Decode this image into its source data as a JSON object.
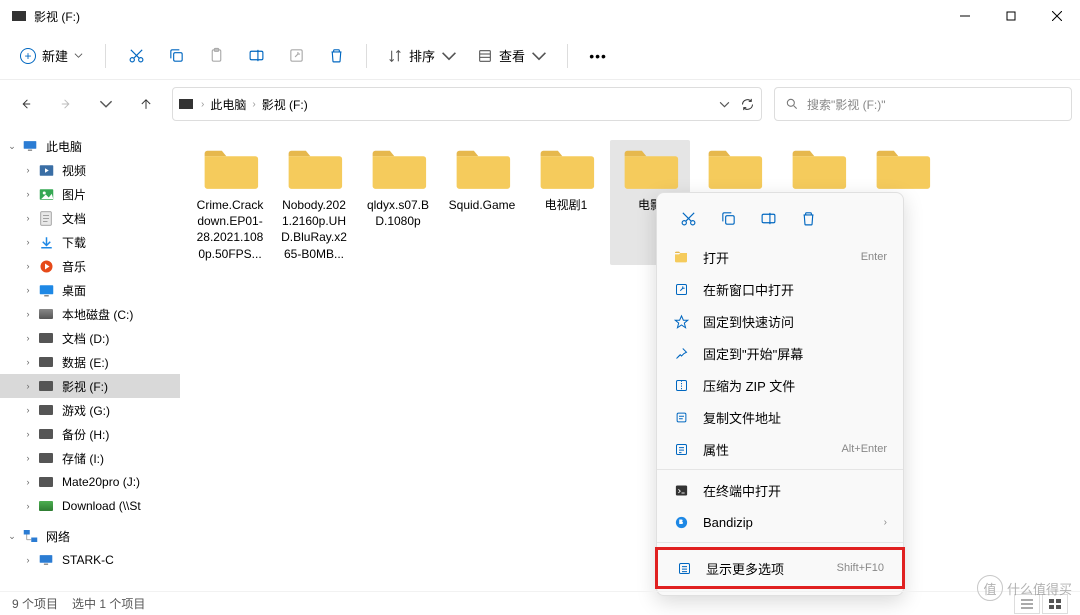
{
  "window": {
    "title": "影视 (F:)"
  },
  "toolbar": {
    "new_label": "新建",
    "sort_label": "排序",
    "view_label": "查看"
  },
  "breadcrumb": {
    "seg1": "此电脑",
    "seg2": "影视 (F:)"
  },
  "search": {
    "placeholder": "搜索\"影视 (F:)\""
  },
  "sidebar": {
    "this_pc": "此电脑",
    "items": [
      {
        "label": "视频"
      },
      {
        "label": "图片"
      },
      {
        "label": "文档"
      },
      {
        "label": "下载"
      },
      {
        "label": "音乐"
      },
      {
        "label": "桌面"
      },
      {
        "label": "本地磁盘 (C:)"
      },
      {
        "label": "文档 (D:)"
      },
      {
        "label": "数据 (E:)"
      },
      {
        "label": "影视 (F:)"
      },
      {
        "label": "游戏 (G:)"
      },
      {
        "label": "备份 (H:)"
      },
      {
        "label": "存储 (I:)"
      },
      {
        "label": "Mate20pro (J:)"
      },
      {
        "label": "Download (\\\\St"
      }
    ],
    "network": "网络",
    "network_child": "STARK-C"
  },
  "folders": [
    {
      "name": "Crime.Crackdown.EP01-28.2021.1080p.50FPS..."
    },
    {
      "name": "Nobody.2021.2160p.UHD.BluRay.x265-B0MB..."
    },
    {
      "name": "qldyx.s07.BD.1080p"
    },
    {
      "name": "Squid.Game"
    },
    {
      "name": "电视剧1"
    },
    {
      "name": "电影"
    },
    {
      "name": ""
    },
    {
      "name": ""
    },
    {
      "name": ""
    }
  ],
  "ctx": {
    "open": "打开",
    "open_sc": "Enter",
    "new_window": "在新窗口中打开",
    "pin_quick": "固定到快速访问",
    "pin_start": "固定到\"开始\"屏幕",
    "zip": "压缩为 ZIP 文件",
    "copy_path": "复制文件地址",
    "props": "属性",
    "props_sc": "Alt+Enter",
    "terminal": "在终端中打开",
    "bandizip": "Bandizip",
    "more": "显示更多选项",
    "more_sc": "Shift+F10"
  },
  "status": {
    "count": "9 个项目",
    "selected": "选中 1 个项目"
  },
  "watermark": {
    "char": "值",
    "text": "什么值得买"
  }
}
